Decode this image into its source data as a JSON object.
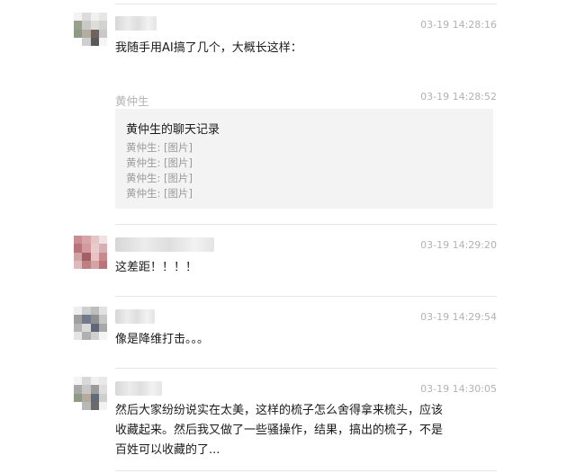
{
  "messages": [
    {
      "time": "03-19 14:28:16",
      "text": "我随手用AI搞了几个，大概长这样："
    },
    {
      "sender": "黄仲生",
      "time": "03-19 14:28:52",
      "card": {
        "title": "黄仲生的聊天记录",
        "lines": [
          "黄仲生: [图片]",
          "黄仲生: [图片]",
          "黄仲生: [图片]",
          "黄仲生: [图片]"
        ]
      }
    },
    {
      "time": "03-19 14:29:20",
      "text": "这差距！！！！"
    },
    {
      "time": "03-19 14:29:54",
      "text": "像是降维打击。。。"
    },
    {
      "time": "03-19 14:30:05",
      "lines": [
        "然后大家纷纷说实在太美，这样的梳子怎么舍得拿来梳头，应该",
        "收藏起来。然后我又做了一些骚操作，结果，搞出的梳子，不是",
        "百姓可以收藏的了..."
      ]
    }
  ],
  "colors": {
    "time": "#b2b2b2",
    "divider": "#e6e6e6",
    "card_bg": "#f3f3f3",
    "card_text": "#9b9b9b"
  },
  "icons": [
    "avatar-pixelated"
  ]
}
